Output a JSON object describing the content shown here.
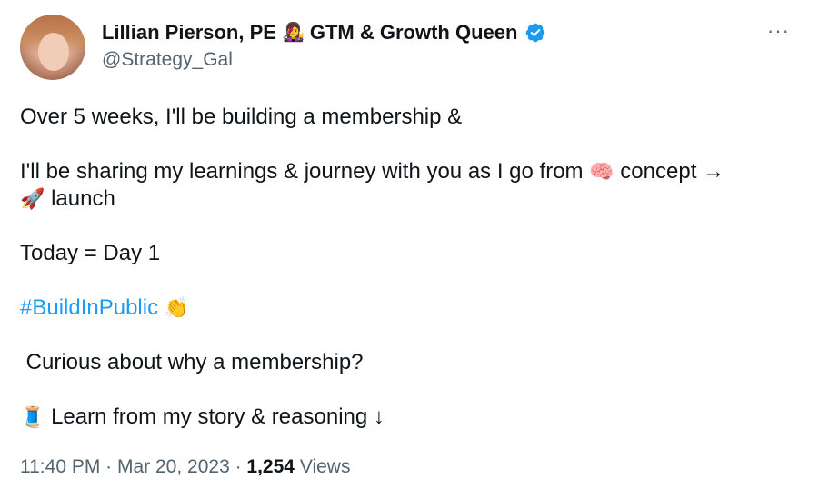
{
  "author": {
    "name": "Lillian Pierson, PE",
    "name_emoji": "👩‍🎤",
    "title": "GTM & Growth Queen",
    "handle": "@Strategy_Gal",
    "verified": true
  },
  "menu": {
    "more_label": "···"
  },
  "tweet": {
    "line1": "Over 5 weeks, I'll be building a membership &",
    "line2_a": "I'll be sharing my learnings & journey with you as I go from",
    "line2_emoji": "🧠",
    "line2_b": "concept →",
    "line3_emoji": "🚀",
    "line3_b": "launch",
    "line4": "Today = Day 1",
    "hashtag": "#BuildInPublic",
    "hashtag_emoji": "👏",
    "line6": "Curious about why a membership?",
    "line7_emoji": "🧵",
    "line7_b": "Learn from my story & reasoning ↓"
  },
  "meta": {
    "time": "11:40 PM",
    "sep1": " · ",
    "date": "Mar 20, 2023",
    "sep2": " · ",
    "views_count": "1,254",
    "views_label": "Views"
  },
  "colors": {
    "link": "#1d9bf0",
    "secondary_text": "#536471",
    "primary_text": "#0f1419",
    "verified_badge": "#1d9bf0"
  }
}
